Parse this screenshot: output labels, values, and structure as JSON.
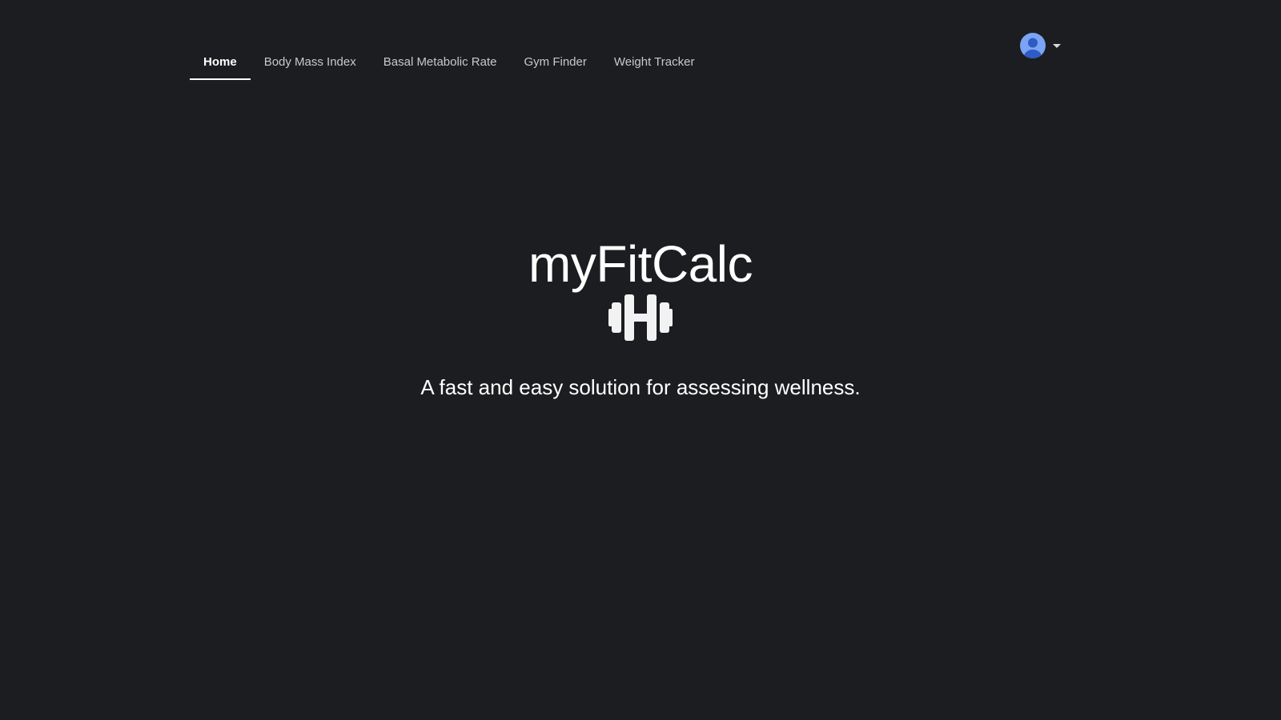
{
  "nav": {
    "items": [
      {
        "label": "Home",
        "active": true
      },
      {
        "label": "Body Mass Index",
        "active": false
      },
      {
        "label": "Basal Metabolic Rate",
        "active": false
      },
      {
        "label": "Gym Finder",
        "active": false
      },
      {
        "label": "Weight Tracker",
        "active": false
      }
    ]
  },
  "account": {
    "avatar_icon": "user-circle-icon",
    "menu_icon": "caret-down-icon",
    "avatar_color": "#7ba4f5"
  },
  "hero": {
    "title": "myFitCalc",
    "icon": "dumbbell-icon",
    "tagline": "A fast and easy solution for assessing wellness."
  },
  "colors": {
    "background": "#1c1d20",
    "text": "#ffffff",
    "nav_inactive": "#c9c9c9"
  }
}
